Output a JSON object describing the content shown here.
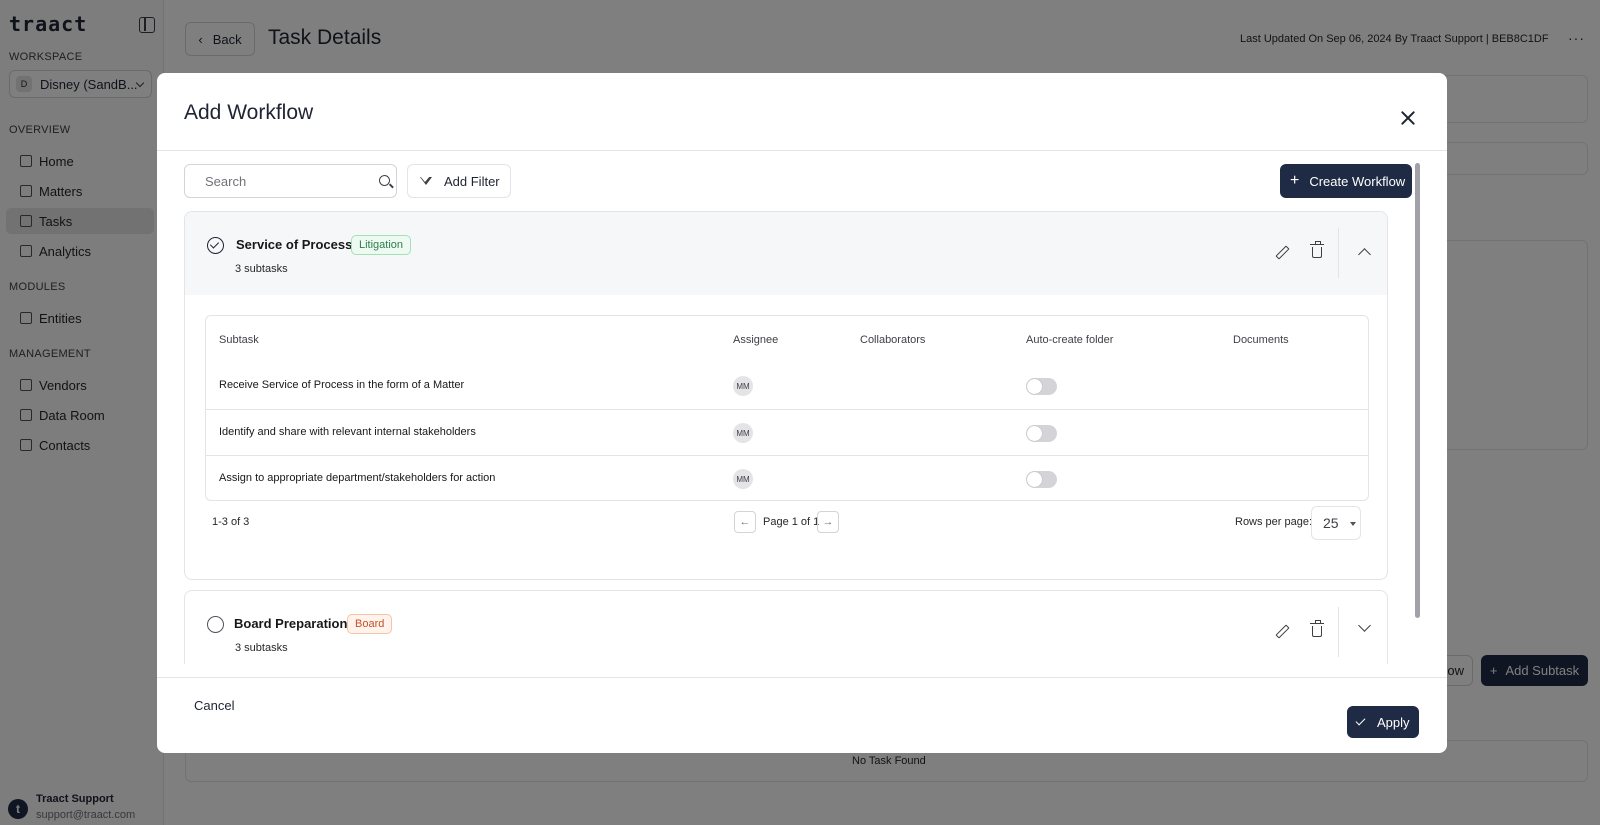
{
  "app": {
    "logo": "traact",
    "workspace_label": "WORKSPACE",
    "workspace_badge": "D",
    "workspace_name": "Disney (SandB...",
    "sections": {
      "overview": "OVERVIEW",
      "modules": "MODULES",
      "management": "MANAGEMENT"
    },
    "nav": {
      "home": "Home",
      "matters": "Matters",
      "tasks": "Tasks",
      "analytics": "Analytics",
      "entities": "Entities",
      "vendors": "Vendors",
      "data_room": "Data Room",
      "contacts": "Contacts"
    },
    "user": {
      "initial": "t",
      "name": "Traact Support",
      "email": "support@traact.com"
    }
  },
  "page": {
    "back_label": "Back",
    "title": "Task Details",
    "meta": "Last Updated On Sep 06, 2024 By Traact Support  |  BEB8C1DF",
    "more": "···",
    "workflow_btn_partial": "llow",
    "add_subtask": "Add Subtask",
    "no_task": "No Task Found"
  },
  "modal": {
    "title": "Add Workflow",
    "search_placeholder": "Search",
    "add_filter": "Add Filter",
    "create_workflow": "Create Workflow",
    "cancel": "Cancel",
    "apply": "Apply",
    "workflows": [
      {
        "name": "Service of Process",
        "tag": "Litigation",
        "subtask_count": "3 subtasks",
        "selected": true,
        "expanded": true,
        "table": {
          "headers": {
            "subtask": "Subtask",
            "assignee": "Assignee",
            "collaborators": "Collaborators",
            "auto_create": "Auto-create folder",
            "documents": "Documents"
          },
          "rows": [
            {
              "subtask": "Receive Service of Process in the form of a Matter",
              "assignee": "MM",
              "auto_create_folder": false
            },
            {
              "subtask": "Identify and share with relevant internal stakeholders",
              "assignee": "MM",
              "auto_create_folder": false
            },
            {
              "subtask": "Assign to appropriate department/stakeholders for action",
              "assignee": "MM",
              "auto_create_folder": false
            }
          ],
          "range": "1-3 of 3",
          "page": "Page 1 of 1",
          "rows_per_page_label": "Rows per page:",
          "rows_per_page": "25",
          "prev": "←",
          "next": "→"
        }
      },
      {
        "name": "Board Preparation",
        "tag": "Board",
        "subtask_count": "3 subtasks",
        "selected": false,
        "expanded": false
      }
    ]
  },
  "colors": {
    "primary": "#1f2a44",
    "litigation_tag": "#2f7d4a",
    "board_tag": "#c2532a"
  }
}
